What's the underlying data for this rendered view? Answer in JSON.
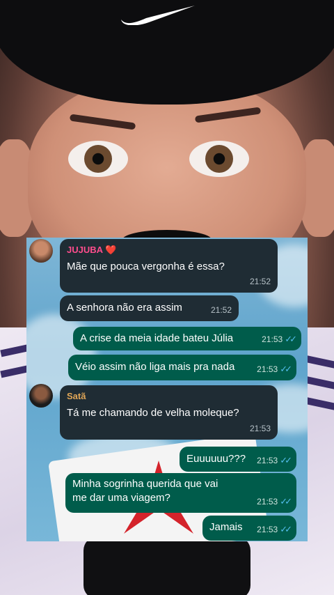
{
  "messages": [
    {
      "sender": "JUJUBA",
      "sender_badge": "❤️",
      "sender_color": "#ff4d8d",
      "text": "Mãe que pouca vergonha é essa?",
      "time": "21:52",
      "direction": "in"
    },
    {
      "text": "A senhora não era assim",
      "time": "21:52",
      "direction": "in"
    },
    {
      "text": "A crise da meia idade bateu Júlia",
      "time": "21:53",
      "direction": "out",
      "status": "read"
    },
    {
      "text": "Véio assim não liga mais pra nada",
      "time": "21:53",
      "direction": "out",
      "status": "read"
    },
    {
      "sender": "Satã",
      "sender_color": "#e0a657",
      "text": "Tá me chamando de velha moleque?",
      "time": "21:53",
      "direction": "in"
    },
    {
      "text": "Euuuuuu???",
      "time": "21:53",
      "direction": "out",
      "status": "read"
    },
    {
      "text": "Minha sogrinha querida que vai me dar uma viagem?",
      "time": "21:53",
      "direction": "out",
      "status": "read"
    },
    {
      "text": "Jamais",
      "time": "21:53",
      "direction": "out",
      "status": "read"
    }
  ],
  "read_tick": "✓✓",
  "colors": {
    "incoming_bubble": "#1f2c34",
    "outgoing_bubble": "#005c4b",
    "read_tick": "#53bdeb"
  },
  "icons": [
    "nike-swoosh-icon",
    "heart-icon",
    "read-receipt-icon"
  ]
}
